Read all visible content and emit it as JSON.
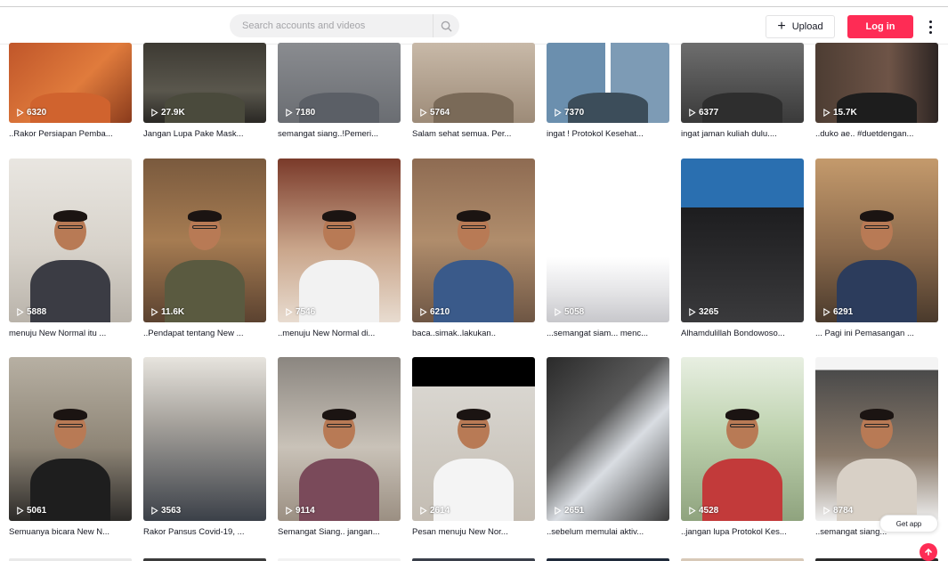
{
  "header": {
    "search_placeholder": "Search accounts and videos",
    "upload_label": "Upload",
    "login_label": "Log in"
  },
  "colors": {
    "accent": "#fe2c55",
    "text": "#161823"
  },
  "videos": [
    {
      "views": "6320",
      "caption": "..Rakor Persiapan Pemba..."
    },
    {
      "views": "27.9K",
      "caption": "Jangan Lupa Pake Mask..."
    },
    {
      "views": "7180",
      "caption": "semangat siang..!Pemeri..."
    },
    {
      "views": "5764",
      "caption": "Salam sehat semua. Per..."
    },
    {
      "views": "7370",
      "caption": "ingat ! Protokol Kesehat..."
    },
    {
      "views": "6377",
      "caption": "ingat jaman kuliah dulu...."
    },
    {
      "views": "15.7K",
      "caption": "..duko ae.. #duetdengan..."
    },
    {
      "views": "5888",
      "caption": "menuju New Normal itu ..."
    },
    {
      "views": "11.6K",
      "caption": "..Pendapat tentang New ..."
    },
    {
      "views": "7546",
      "caption": "..menuju New Normal di..."
    },
    {
      "views": "6210",
      "caption": "baca..simak..lakukan.."
    },
    {
      "views": "5058",
      "caption": "...semangat siam... menc..."
    },
    {
      "views": "3265",
      "caption": "Alhamdulillah Bondowoso..."
    },
    {
      "views": "6291",
      "caption": "... Pagi ini Pemasangan ..."
    },
    {
      "views": "5061",
      "caption": "Semuanya bicara New N..."
    },
    {
      "views": "3563",
      "caption": "Rakor Pansus Covid-19, ..."
    },
    {
      "views": "9114",
      "caption": "Semangat Siang.. jangan..."
    },
    {
      "views": "2614",
      "caption": "Pesan menuju New Nor..."
    },
    {
      "views": "2651",
      "caption": "..sebelum memulai aktiv..."
    },
    {
      "views": "4528",
      "caption": "..jangan lupa Protokol Kes..."
    },
    {
      "views": "8784",
      "caption": "..semangat siang..."
    }
  ],
  "floating": {
    "get_app_label": "Get app"
  }
}
